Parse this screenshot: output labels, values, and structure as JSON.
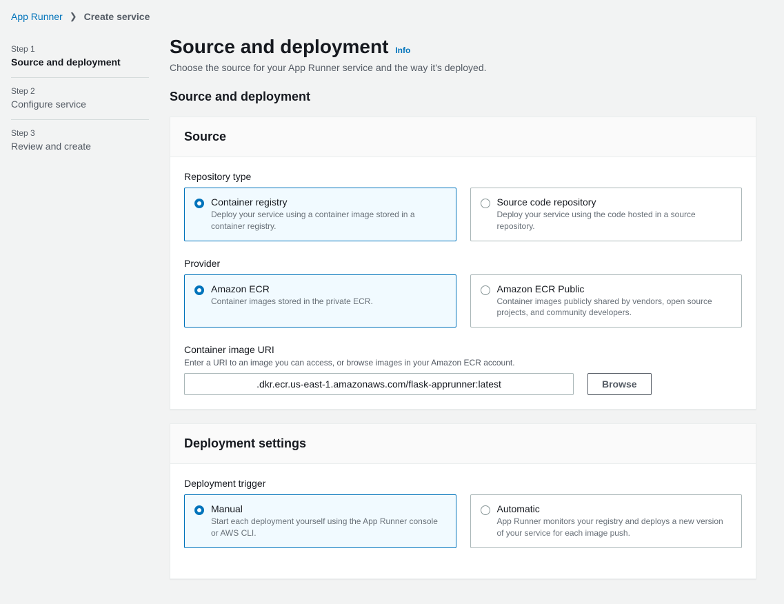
{
  "breadcrumb": {
    "service": "App Runner",
    "current": "Create service"
  },
  "sidebar": {
    "steps": [
      {
        "label": "Step 1",
        "name": "Source and deployment"
      },
      {
        "label": "Step 2",
        "name": "Configure service"
      },
      {
        "label": "Step 3",
        "name": "Review and create"
      }
    ]
  },
  "page": {
    "title": "Source and deployment",
    "info": "Info",
    "description": "Choose the source for your App Runner service and the way it's deployed.",
    "formTitle": "Source and deployment"
  },
  "source": {
    "panelTitle": "Source",
    "repoTypeLabel": "Repository type",
    "repoTypes": [
      {
        "title": "Container registry",
        "desc": "Deploy your service using a container image stored in a container registry."
      },
      {
        "title": "Source code repository",
        "desc": "Deploy your service using the code hosted in a source repository."
      }
    ],
    "providerLabel": "Provider",
    "providers": [
      {
        "title": "Amazon ECR",
        "desc": "Container images stored in the private ECR."
      },
      {
        "title": "Amazon ECR Public",
        "desc": "Container images publicly shared by vendors, open source projects, and community developers."
      }
    ],
    "imageUri": {
      "label": "Container image URI",
      "hint": "Enter a URI to an image you can access, or browse images in your Amazon ECR account.",
      "value": ".dkr.ecr.us-east-1.amazonaws.com/flask-apprunner:latest",
      "browse": "Browse"
    }
  },
  "deployment": {
    "panelTitle": "Deployment settings",
    "triggerLabel": "Deployment trigger",
    "triggers": [
      {
        "title": "Manual",
        "desc": "Start each deployment yourself using the App Runner console or AWS CLI."
      },
      {
        "title": "Automatic",
        "desc": "App Runner monitors your registry and deploys a new version of your service for each image push."
      }
    ]
  }
}
